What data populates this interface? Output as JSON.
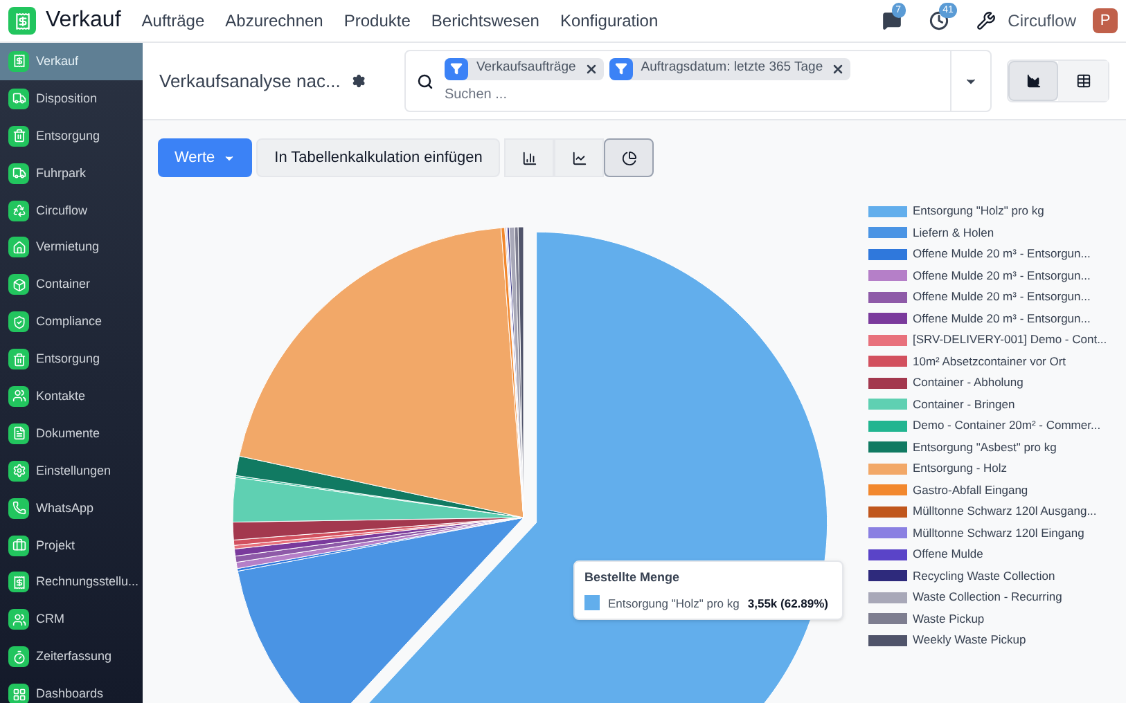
{
  "topbar": {
    "app_name": "Verkauf",
    "menu": [
      "Aufträge",
      "Abzurechnen",
      "Produkte",
      "Berichtswesen",
      "Konfiguration"
    ],
    "messages_badge": "7",
    "activities_badge": "41",
    "company": "Circuflow",
    "avatar": "P"
  },
  "sidebar": {
    "items": [
      {
        "label": "Verkauf",
        "selected": true
      },
      {
        "label": "Disposition",
        "selected": false
      },
      {
        "label": "Entsorgung",
        "selected": false
      },
      {
        "label": "Fuhrpark",
        "selected": false
      },
      {
        "label": "Circuflow",
        "selected": false
      },
      {
        "label": "Vermietung",
        "selected": false
      },
      {
        "label": "Container",
        "selected": false
      },
      {
        "label": "Compliance",
        "selected": false
      },
      {
        "label": "Entsorgung",
        "selected": false
      },
      {
        "label": "Kontakte",
        "selected": false
      },
      {
        "label": "Dokumente",
        "selected": false
      },
      {
        "label": "Einstellungen",
        "selected": false
      },
      {
        "label": "WhatsApp",
        "selected": false
      },
      {
        "label": "Projekt",
        "selected": false
      },
      {
        "label": "Rechnungsstellu...",
        "selected": false
      },
      {
        "label": "CRM",
        "selected": false
      },
      {
        "label": "Zeiterfassung",
        "selected": false
      },
      {
        "label": "Dashboards",
        "selected": false
      }
    ]
  },
  "control_panel": {
    "title": "Verkaufsanalyse nac...",
    "filters": [
      {
        "label": "Verkaufsaufträge"
      },
      {
        "label": "Auftragsdatum: letzte 365 Tage"
      }
    ],
    "search": {
      "placeholder": "Suchen ..."
    },
    "views": [
      {
        "kind": "graph",
        "selected": true
      },
      {
        "kind": "pivot",
        "selected": false
      }
    ]
  },
  "toolbar": {
    "measures_button": "Werte",
    "spreadsheet_button": "In Tabellenkalkulation einfügen",
    "chart_types": [
      {
        "kind": "bar",
        "selected": false
      },
      {
        "kind": "line",
        "selected": false
      },
      {
        "kind": "pie",
        "selected": true
      }
    ]
  },
  "legend": [
    {
      "label": "Entsorgung \"Holz\" pro kg",
      "color": "#62aeec"
    },
    {
      "label": "Liefern & Holen",
      "color": "#4a94e4"
    },
    {
      "label": "Offene Mulde 20 m³ - Entsorgun...",
      "color": "#2f78dc"
    },
    {
      "label": "Offene Mulde 20 m³ - Entsorgun...",
      "color": "#b57fc8"
    },
    {
      "label": "Offene Mulde 20 m³ - Entsorgun...",
      "color": "#8e5aa8"
    },
    {
      "label": "Offene Mulde 20 m³ - Entsorgun...",
      "color": "#7a3a9c"
    },
    {
      "label": "[SRV-DELIVERY-001] Demo - Cont...",
      "color": "#e8717c"
    },
    {
      "label": "10m² Absetzcontainer vor Ort",
      "color": "#d2505e"
    },
    {
      "label": "Container - Abholung",
      "color": "#a3384e"
    },
    {
      "label": "Container - Bringen",
      "color": "#5fd0b2"
    },
    {
      "label": "Demo - Container 20m² - Commer...",
      "color": "#22b590"
    },
    {
      "label": "Entsorgung \"Asbest\" pro kg",
      "color": "#117a62"
    },
    {
      "label": "Entsorgung - Holz",
      "color": "#f2a868"
    },
    {
      "label": "Gastro-Abfall Eingang",
      "color": "#f2882e"
    },
    {
      "label": "Mülltonne Schwarz 120l Ausgang...",
      "color": "#c0561c"
    },
    {
      "label": "Mülltonne Schwarz 120l Eingang",
      "color": "#8a80e2"
    },
    {
      "label": "Offene Mulde",
      "color": "#5a44c8"
    },
    {
      "label": "Recycling Waste Collection",
      "color": "#2e2a7c"
    },
    {
      "label": "Waste Collection - Recurring",
      "color": "#a8a8b8"
    },
    {
      "label": "Waste Pickup",
      "color": "#7e7e90"
    },
    {
      "label": "Weekly Waste Pickup",
      "color": "#50546a"
    }
  ],
  "tooltip": {
    "title": "Bestellte Menge",
    "label": "Entsorgung \"Holz\" pro kg",
    "value": "3,55k (62.89%)",
    "color": "#62aeec"
  }
}
